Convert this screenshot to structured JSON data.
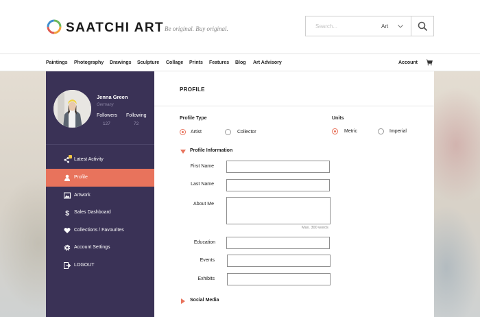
{
  "header": {
    "brand": "SAATCHI ART",
    "tagline": "Be original. Buy original.",
    "search_placeholder": "Search...",
    "search_category": "Art"
  },
  "nav": {
    "items": [
      "Paintings",
      "Photography",
      "Drawings",
      "Sculpture",
      "Collage",
      "Prints",
      "Features",
      "Blog",
      "Art Advisory"
    ],
    "account": "Account"
  },
  "profile": {
    "name": "Jenna Green",
    "location": "Germany",
    "followers_label": "Followers",
    "followers_count": "127",
    "following_label": "Following",
    "following_count": "72"
  },
  "sidebar": {
    "items": [
      {
        "label": "Latest Activity",
        "icon": "activity-icon",
        "active": false
      },
      {
        "label": "Profile",
        "icon": "user-icon",
        "active": true
      },
      {
        "label": "Artwork",
        "icon": "image-icon",
        "active": false
      },
      {
        "label": "Sales Dashboard",
        "icon": "dollar-icon",
        "active": false
      },
      {
        "label": "Collections / Favourites",
        "icon": "heart-icon",
        "active": false
      },
      {
        "label": "Account Settings",
        "icon": "gear-icon",
        "active": false
      },
      {
        "label": "LOGOUT",
        "icon": "logout-icon",
        "active": false
      }
    ]
  },
  "main": {
    "title": "PROFILE",
    "profile_type": {
      "label": "Profile Type",
      "options": [
        "Artist",
        "Collector"
      ],
      "selected": "Artist"
    },
    "units": {
      "label": "Units",
      "options": [
        "Metric",
        "Imperial"
      ],
      "selected": "Metric"
    },
    "profile_info_title": "Profile Information",
    "fields": {
      "first_name": {
        "label": "First Name",
        "value": ""
      },
      "last_name": {
        "label": "Last Name",
        "value": ""
      },
      "about_me": {
        "label": "About Me",
        "value": "",
        "hint": "Max. 300 words"
      },
      "education": {
        "label": "Education",
        "value": ""
      },
      "events": {
        "label": "Events",
        "value": ""
      },
      "exhibits": {
        "label": "Exhibits",
        "value": ""
      }
    },
    "social_media_title": "Social Media"
  },
  "colors": {
    "accent": "#e8735c",
    "sidebar_bg": "#3a3256",
    "badge": "#f2c744"
  }
}
